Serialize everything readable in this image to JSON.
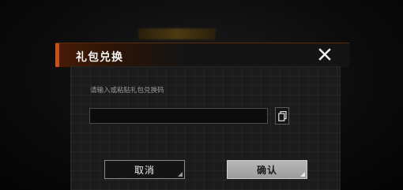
{
  "dialog": {
    "title": "礼包兑换",
    "prompt": "请输入或粘贴礼包兑换码",
    "code_input": {
      "value": "",
      "placeholder": ""
    },
    "paste_icon": "clipboard-icon",
    "close_icon": "close-icon",
    "cancel_label": "取消",
    "confirm_label": "确认"
  },
  "colors": {
    "header_accent": "#c8501a",
    "confirm_button": "#a8a8a8",
    "cancel_button": "#141414"
  }
}
